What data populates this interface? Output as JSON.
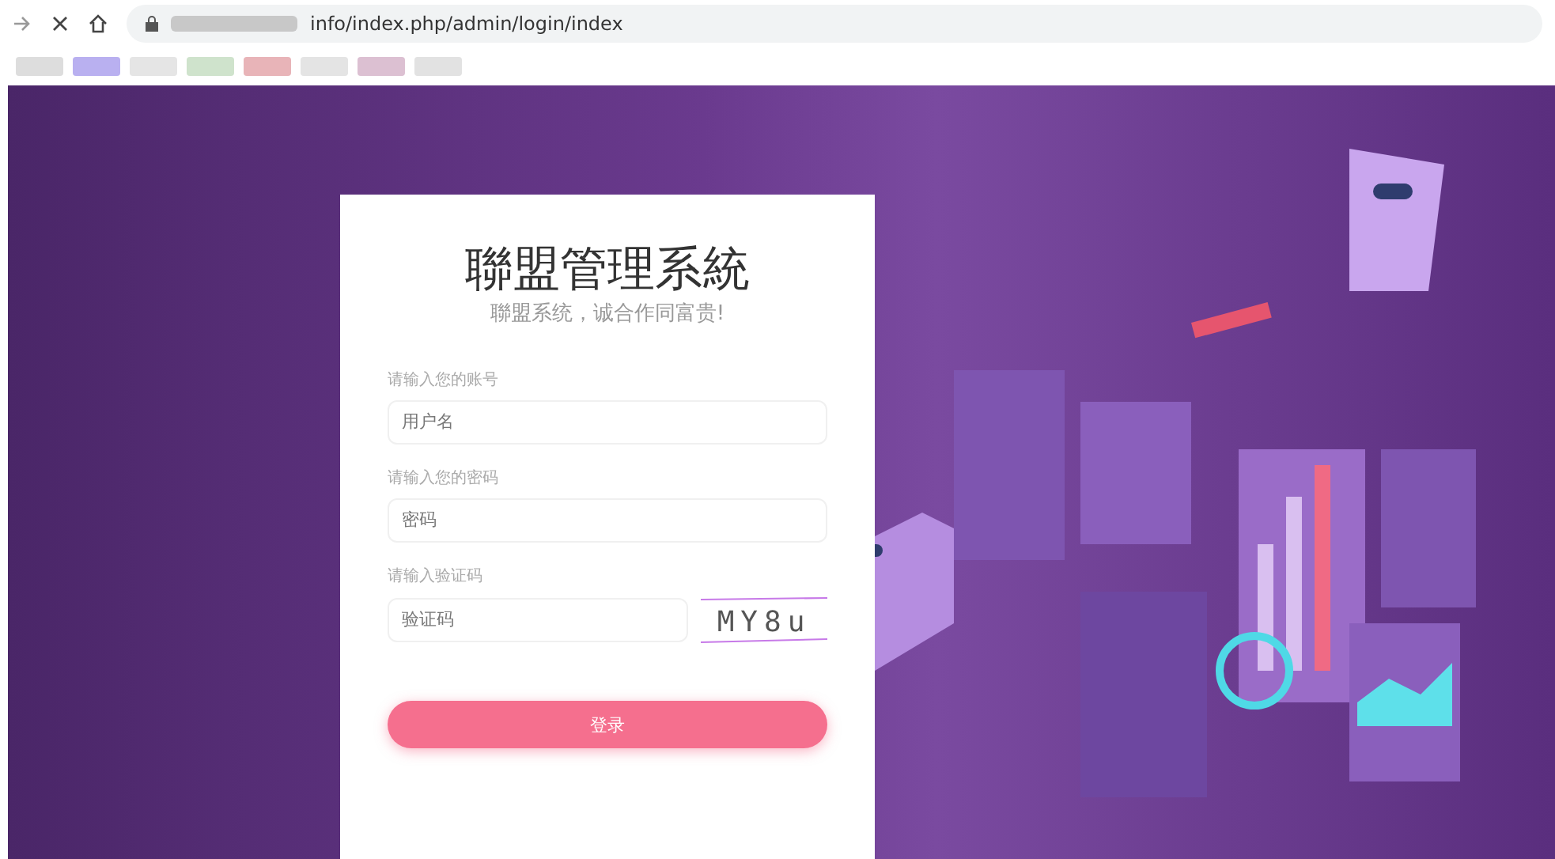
{
  "browser": {
    "url": "info/index.php/admin/login/index"
  },
  "login": {
    "title": "聯盟管理系統",
    "subtitle": "聯盟系统，诚合作同富贵!",
    "fields": [
      {
        "kind": "text",
        "label": "请输入您的账号",
        "placeholder": "用户名"
      },
      {
        "kind": "password",
        "label": "请输入您的密码",
        "placeholder": "密码"
      },
      {
        "kind": "captcha",
        "label": "请输入验证码",
        "placeholder": "验证码",
        "captcha_text": "MY8u"
      }
    ],
    "submit": "登录"
  }
}
